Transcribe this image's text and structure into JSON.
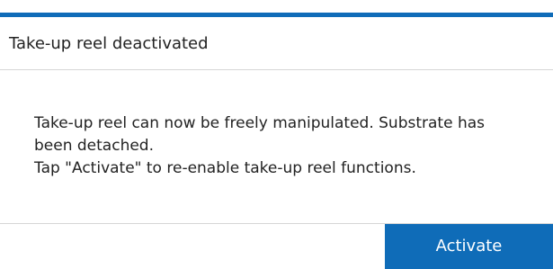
{
  "dialog": {
    "title": "Take-up reel deactivated",
    "message_lines": [
      "Take-up reel can now be freely manipulated. Substrate has been detached.",
      "Tap \"Activate\" to re-enable take-up reel functions."
    ],
    "activate_label": "Activate"
  },
  "colors": {
    "accent": "#0f6cb8",
    "divider": "#d6d6d6",
    "text": "#222222",
    "background": "#ffffff"
  }
}
